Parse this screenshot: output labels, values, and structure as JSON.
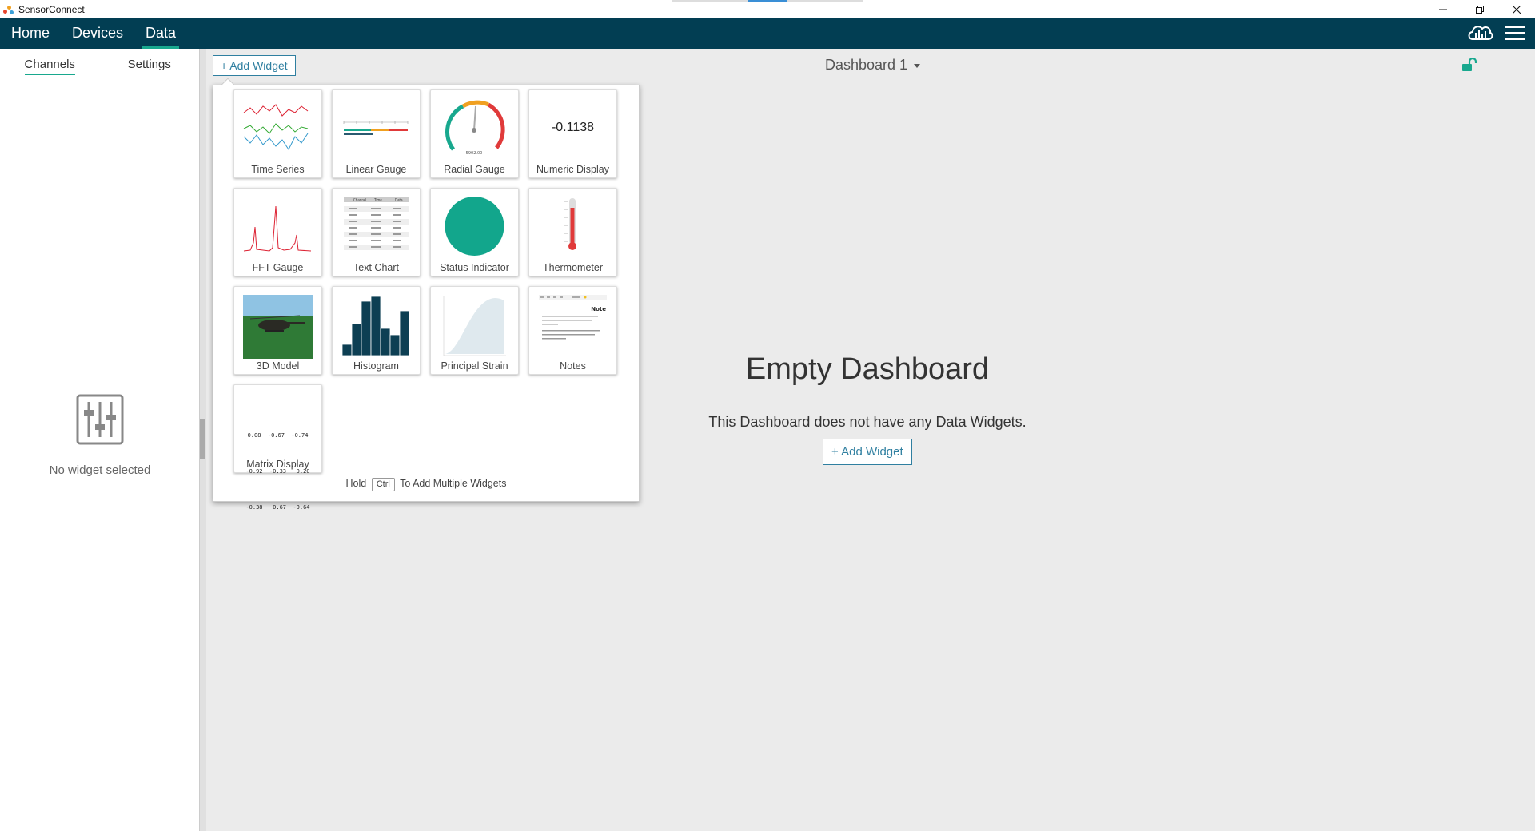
{
  "window": {
    "title": "SensorConnect",
    "minimize_icon": "minimize-icon",
    "restore_icon": "restore-icon",
    "close_icon": "close-icon"
  },
  "nav": {
    "items": [
      {
        "label": "Home"
      },
      {
        "label": "Devices"
      },
      {
        "label": "Data",
        "active": true
      }
    ]
  },
  "left_panel": {
    "tabs": [
      {
        "label": "Channels",
        "active": true
      },
      {
        "label": "Settings"
      }
    ],
    "empty_text": "No widget selected"
  },
  "toolbar": {
    "add_widget_label": "+ Add Widget",
    "dashboard_name": "Dashboard 1"
  },
  "picker": {
    "widgets": [
      {
        "label": "Time Series"
      },
      {
        "label": "Linear Gauge"
      },
      {
        "label": "Radial Gauge"
      },
      {
        "label": "Numeric Display"
      },
      {
        "label": "FFT Gauge"
      },
      {
        "label": "Text Chart"
      },
      {
        "label": "Status Indicator"
      },
      {
        "label": "Thermometer"
      },
      {
        "label": "3D Model"
      },
      {
        "label": "Histogram"
      },
      {
        "label": "Principal Strain"
      },
      {
        "label": "Notes"
      },
      {
        "label": "Matrix Display"
      }
    ],
    "numeric_value": "-0.1138",
    "radial_value": "5902.00",
    "notes_title": "Note",
    "matrix_rows": [
      "0.08  -0.67  -0.74",
      "-0.92  -0.33   0.20",
      "-0.38   0.67  -0.64"
    ],
    "text_chart_headers": [
      "Channel",
      "Time",
      "Data"
    ],
    "hint_prefix": "Hold",
    "hint_key": "Ctrl",
    "hint_suffix": "To Add Multiple Widgets"
  },
  "empty": {
    "title": "Empty Dashboard",
    "subtitle": "This Dashboard does not have any Data Widgets.",
    "button_label": "+ Add Widget"
  },
  "colors": {
    "nav_bg": "#023e53",
    "accent": "#18a88e",
    "link": "#2f7fa0",
    "gauge_red": "#e03a3a"
  }
}
